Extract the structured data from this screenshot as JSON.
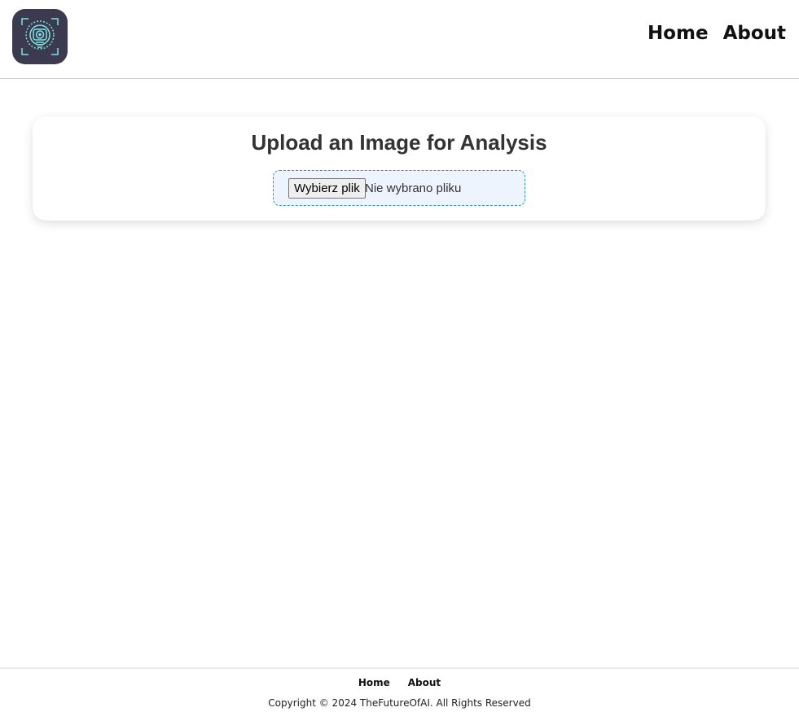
{
  "header": {
    "logo_icon": "camera-lens-robot-icon",
    "nav": [
      {
        "label": "Home"
      },
      {
        "label": "About"
      }
    ]
  },
  "upload": {
    "title": "Upload an Image for Analysis",
    "button_label": "Wybierz plik",
    "status_text": "Nie wybrano pliku"
  },
  "footer": {
    "nav": [
      {
        "label": "Home"
      },
      {
        "label": "About"
      }
    ],
    "copyright": "Copyright © 2024 TheFutureOfAI. All Rights Reserved"
  },
  "colors": {
    "logo_bg": "#3b3a4e",
    "logo_accent": "#7fe3e6",
    "dropzone_border": "#2a8fc7",
    "dropzone_bg": "#eef4fd"
  }
}
